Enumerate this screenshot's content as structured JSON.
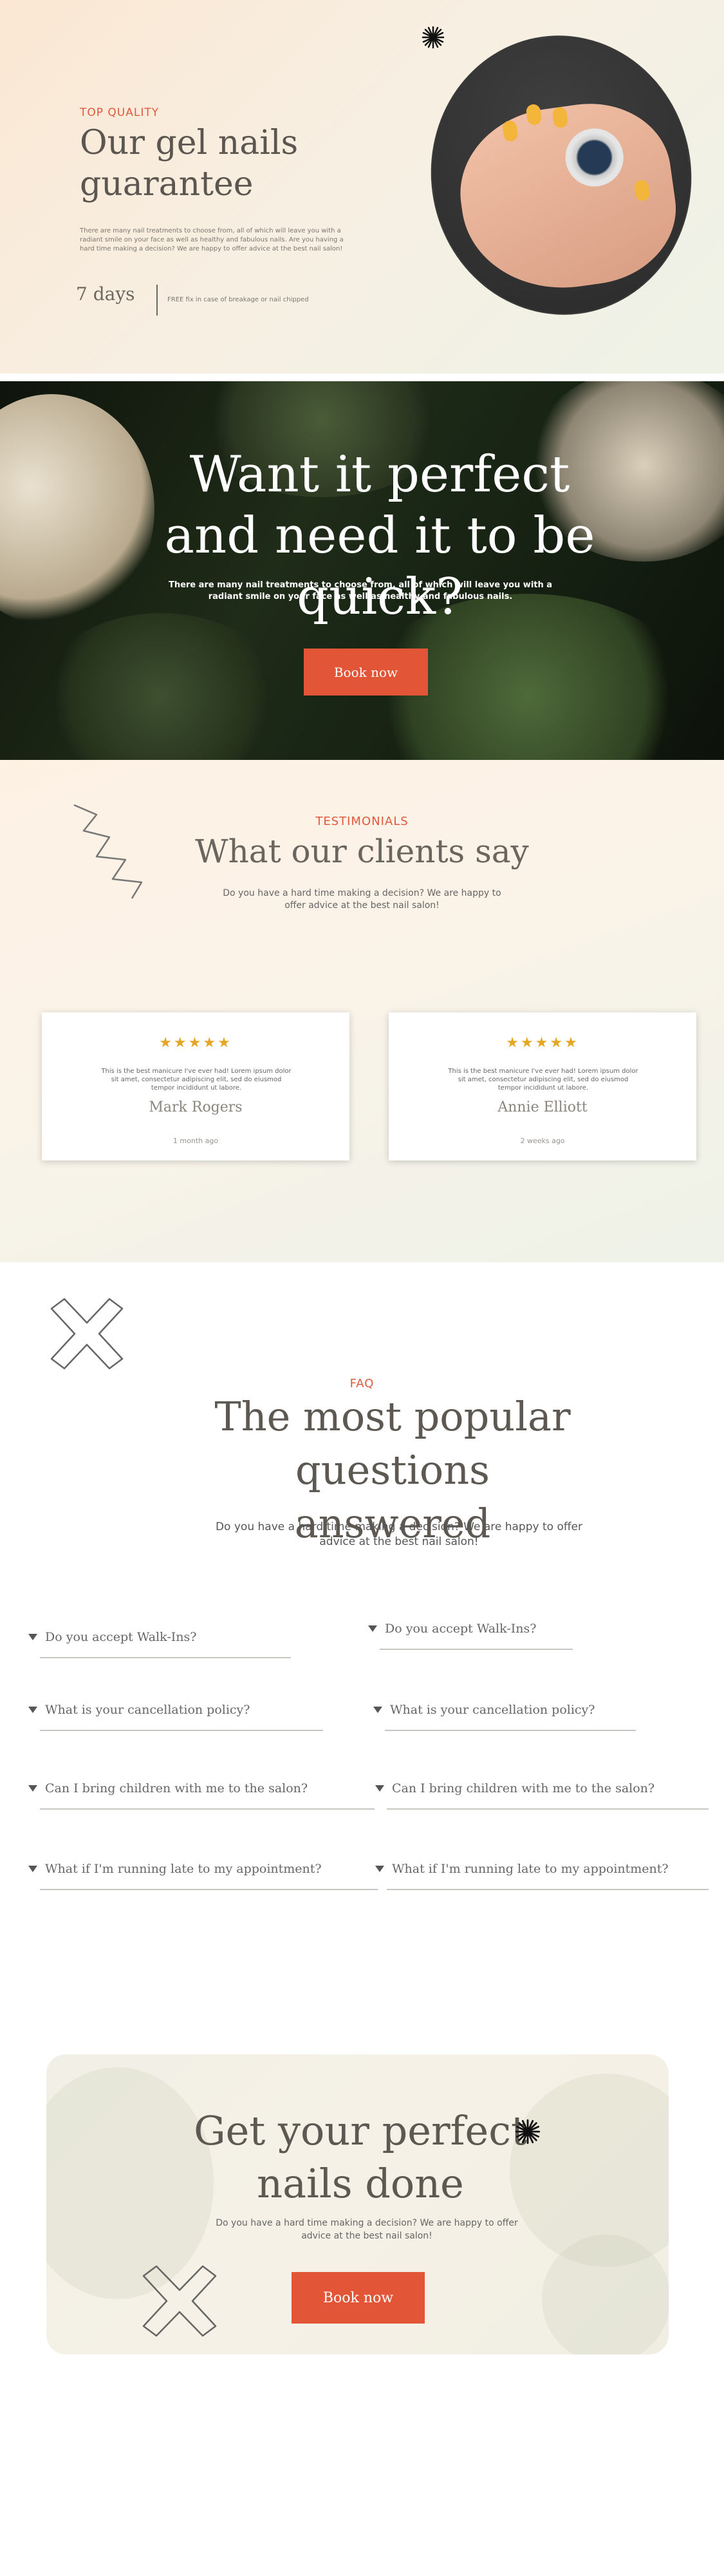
{
  "hero": {
    "eyebrow": "TOP QUALITY",
    "title": "Our gel nails guarantee",
    "text": "There are many nail treatments to choose from, all of which will leave you with a radiant smile on your face as well as healthy and fabulous nails. Are you having a hard time making a decision? We are happy to offer advice at the best nail salon!",
    "days_value": "7 days",
    "days_note": "FREE fix in case of breakage or nail chipped"
  },
  "banner": {
    "title": "Want it perfect and need it to be quick?",
    "subtitle": "There are many nail treatments to choose from, all of which will leave you with a radiant smile on your face as well as healthy and fabulous nails.",
    "button": "Book now"
  },
  "testimonials": {
    "eyebrow": "TESTIMONIALS",
    "title": "What our clients say",
    "subtitle": "Do you have a hard time making a decision? We are happy to offer advice at the best nail salon!",
    "cards": [
      {
        "stars": "★★★★★",
        "quote": "This is the best manicure I've ever had! Lorem ipsum dolor sit amet, consectetur adipiscing elit, sed do eiusmod tempor incididunt ut labore.",
        "name": "Mark Rogers",
        "time": "1 month ago"
      },
      {
        "stars": "★★★★★",
        "quote": "This is the best manicure I've ever had! Lorem ipsum dolor sit amet, consectetur adipiscing elit, sed do eiusmod tempor incididunt ut labore.",
        "name": "Annie Elliott",
        "time": "2 weeks ago"
      }
    ]
  },
  "faq": {
    "eyebrow": "FAQ",
    "title": "The most popular questions answered",
    "subtitle": "Do you have a hard time making a decision? We are happy to offer advice at the best nail salon!",
    "left": [
      "Do you accept Walk-Ins?",
      "What is your cancellation policy?",
      "Can I bring children with me to the salon?",
      "What if I'm running late to my appointment?"
    ],
    "right": [
      "Do you accept Walk-Ins?",
      "What is your cancellation policy?",
      "Can I bring children with me to the salon?",
      "What if I'm running late to my appointment?"
    ]
  },
  "cta": {
    "title": "Get your perfect nails done",
    "subtitle": "Do you have a hard time making a decision? We are happy to offer advice at the best nail salon!",
    "button": "Book now"
  },
  "colors": {
    "accent": "#e35537",
    "eyebrow": "#e0583e",
    "star": "#e4a623",
    "heading": "#5d5851"
  }
}
